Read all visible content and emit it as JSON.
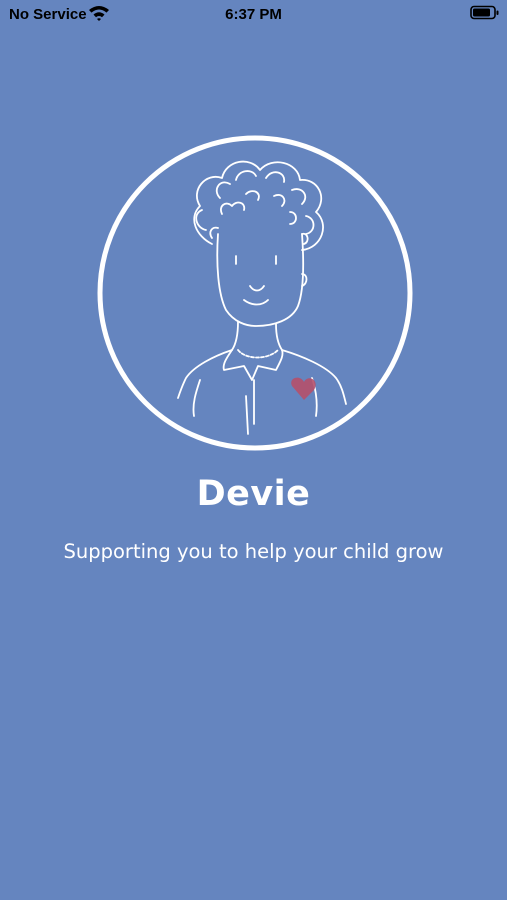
{
  "status_bar": {
    "carrier": "No Service",
    "time": "6:37 PM",
    "wifi_icon": "wifi-icon",
    "battery_icon": "battery-icon"
  },
  "welcome": {
    "illustration": "person-avatar-illustration",
    "title": "Devie",
    "subtitle": "Supporting you to help your child grow"
  },
  "colors": {
    "background": "#6585bf",
    "text": "#ffffff",
    "heart": "#b5506a"
  }
}
